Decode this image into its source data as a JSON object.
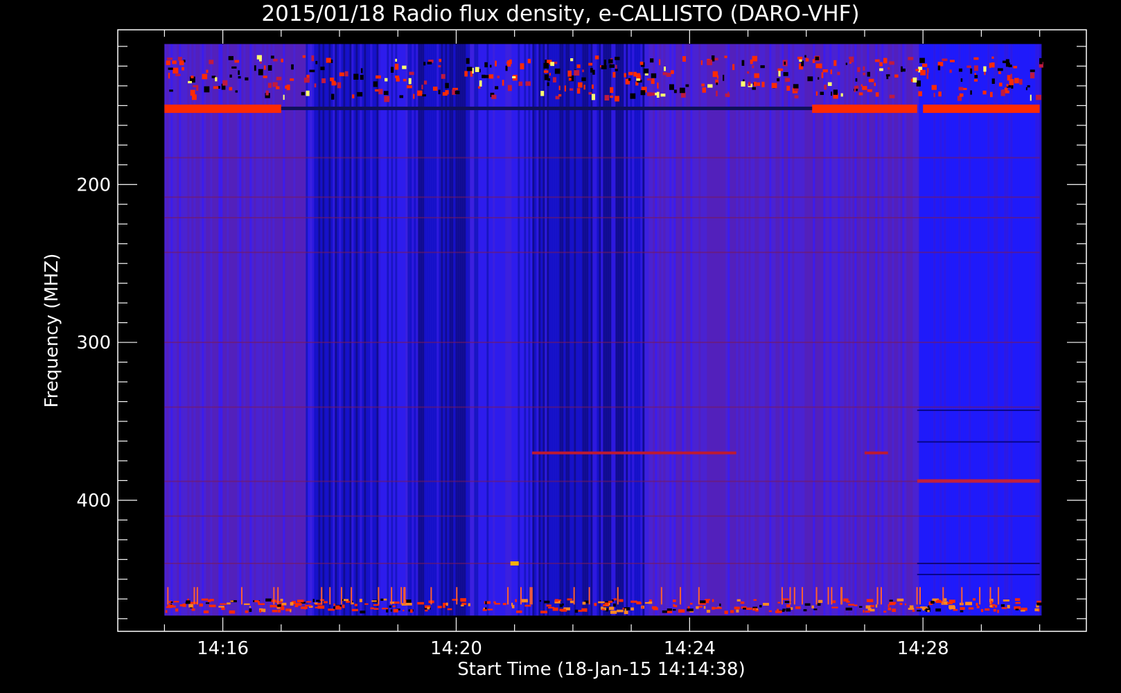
{
  "chart_data": {
    "type": "heatmap",
    "title": "2015/01/18  Radio flux density, e-CALLISTO (DARO-VHF)",
    "xlabel": "Start Time (18-Jan-15 14:14:38)",
    "ylabel": "Frequency (MHZ)",
    "x_ticks": [
      "14:16",
      "14:20",
      "14:24",
      "14:28"
    ],
    "y_ticks": [
      "200",
      "300",
      "400"
    ],
    "x_range_minutes": [
      14.2,
      30.8
    ],
    "data_x_range_minutes": [
      15.0,
      30.0
    ],
    "y_range_mhz": [
      102,
      483
    ],
    "data_y_range_mhz": [
      111,
      473
    ],
    "y_reversed": true,
    "colormap": [
      "#000000",
      "#0000ff",
      "#7a1a9a",
      "#ff2000",
      "#ffff60"
    ],
    "dark_segments_minutes": [
      [
        17.5,
        18.7
      ],
      [
        19.2,
        20.2
      ],
      [
        21.3,
        23.2
      ]
    ],
    "bright_segments_minutes": [
      [
        26.1,
        27.9
      ],
      [
        27.9,
        30.0
      ]
    ],
    "hot_bands_mhz": [
      152,
      370,
      388,
      440,
      465
    ],
    "colors": {
      "background": "#000000",
      "axes": "#ffffff"
    }
  }
}
